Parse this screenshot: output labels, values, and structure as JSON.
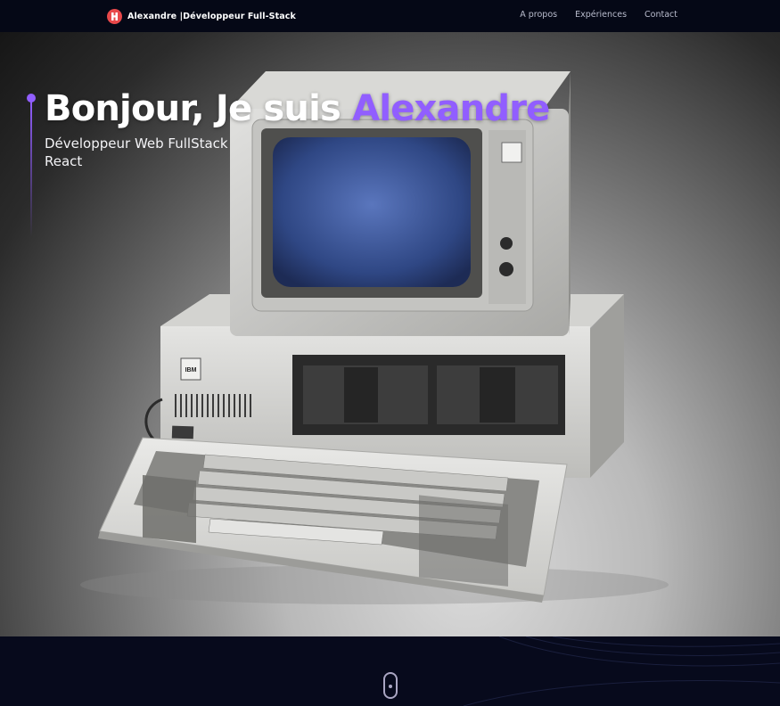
{
  "header": {
    "brand_text": "Alexandre |Développeur Full-Stack",
    "logo_icon": "logo-icon",
    "nav": [
      {
        "label": "A propos"
      },
      {
        "label": "Expériences"
      },
      {
        "label": "Contact"
      }
    ]
  },
  "hero": {
    "title_prefix": "Bonjour, Je suis ",
    "title_name": "Alexandre",
    "subtitle_line1": "Développeur Web FullStack",
    "subtitle_line2": "React",
    "photo_label": "IBM"
  },
  "scroll_indicator_icon": "mouse-scroll-icon",
  "colors": {
    "accent": "#915eff",
    "background": "#050816",
    "logo_red": "#e8484a",
    "nav_text": "#b9bccd"
  }
}
